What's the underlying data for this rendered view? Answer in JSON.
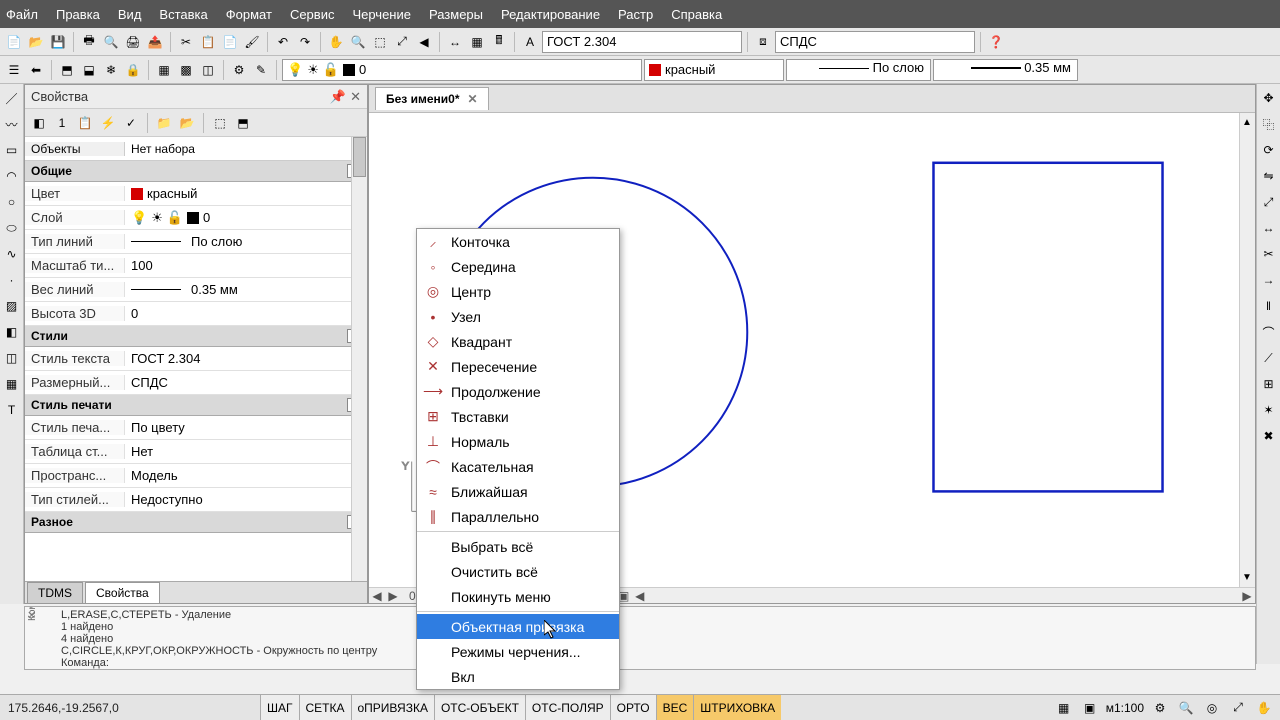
{
  "menubar": [
    "Файл",
    "Правка",
    "Вид",
    "Вставка",
    "Формат",
    "Сервис",
    "Черчение",
    "Размеры",
    "Редактирование",
    "Растр",
    "Справка"
  ],
  "toolbar2": {
    "font_style": "ГОСТ 2.304",
    "dim_style": "СПДС"
  },
  "toolbar3": {
    "layer": "0",
    "color": "красный",
    "color_hex": "#d40000",
    "linetype": "По слою",
    "lineweight": "0.35 мм"
  },
  "props": {
    "title": "Свойства",
    "selector_label": "Объекты",
    "selector_value": "Нет набора",
    "groups": [
      {
        "name": "Общие",
        "rows": [
          {
            "k": "Цвет",
            "v": "красный",
            "sw": "#d40000"
          },
          {
            "k": "Слой",
            "v": "0",
            "layer": true
          },
          {
            "k": "Тип линий",
            "v": "По слою",
            "rule": true
          },
          {
            "k": "Масштаб ти...",
            "v": "100"
          },
          {
            "k": "Вес линий",
            "v": "0.35 мм",
            "rule": true
          },
          {
            "k": "Высота 3D",
            "v": "0"
          }
        ]
      },
      {
        "name": "Стили",
        "rows": [
          {
            "k": "Стиль текста",
            "v": "ГОСТ 2.304"
          },
          {
            "k": "Размерный...",
            "v": "СПДС"
          }
        ]
      },
      {
        "name": "Стиль печати",
        "rows": [
          {
            "k": "Стиль печа...",
            "v": "По цвету"
          },
          {
            "k": "Таблица ст...",
            "v": "Нет"
          },
          {
            "k": "Пространс...",
            "v": "Модель"
          },
          {
            "k": "Тип стилей...",
            "v": "Недоступно"
          }
        ]
      },
      {
        "name": "Разное",
        "rows": []
      }
    ],
    "tabs": [
      "TDMS",
      "Свойства"
    ],
    "active_tab": 1
  },
  "doc": {
    "title": "Без имени0*"
  },
  "context_menu": {
    "items": [
      {
        "label": "Конточка",
        "icon": "endpoint"
      },
      {
        "label": "Середина",
        "icon": "midpoint"
      },
      {
        "label": "Центр",
        "icon": "center"
      },
      {
        "label": "Узел",
        "icon": "node"
      },
      {
        "label": "Квадрант",
        "icon": "quadrant"
      },
      {
        "label": "Пересечение",
        "icon": "intersection"
      },
      {
        "label": "Продолжение",
        "icon": "extension"
      },
      {
        "label": "Твставки",
        "icon": "insert"
      },
      {
        "label": "Нормаль",
        "icon": "perpendicular"
      },
      {
        "label": "Касательная",
        "icon": "tangent"
      },
      {
        "label": "Ближайшая",
        "icon": "nearest"
      },
      {
        "label": "Параллельно",
        "icon": "parallel"
      }
    ],
    "extra": [
      "Выбрать всё",
      "Очистить всё",
      "Покинуть меню"
    ],
    "highlighted": "Объектная привязка",
    "after": [
      "Режимы черчения...",
      "Вкл"
    ]
  },
  "command": {
    "lines": [
      "L,ERASE,С,СТЕРЕТЬ - Удаление",
      "1 найдено",
      "4 найдено",
      "C,CIRCLE,К,КРУГ,ОКР,ОКРУЖНОСТЬ - Окружность по центру"
    ],
    "prompt": "Команда:"
  },
  "status": {
    "coords": "175.2646,-19.2567,0",
    "toggles": [
      {
        "label": "ШАГ",
        "on": false
      },
      {
        "label": "СЕТКА",
        "on": false
      },
      {
        "label": "оПРИВЯЗКА",
        "on": false
      },
      {
        "label": "ОТС-ОБЪЕКТ",
        "on": false
      },
      {
        "label": "ОТС-ПОЛЯР",
        "on": false
      },
      {
        "label": "ОРТО",
        "on": false
      },
      {
        "label": "ВЕС",
        "on": true
      },
      {
        "label": "ШТРИХОВКА",
        "on": true
      }
    ],
    "scale": "м1:100"
  },
  "ruler_label": "0"
}
